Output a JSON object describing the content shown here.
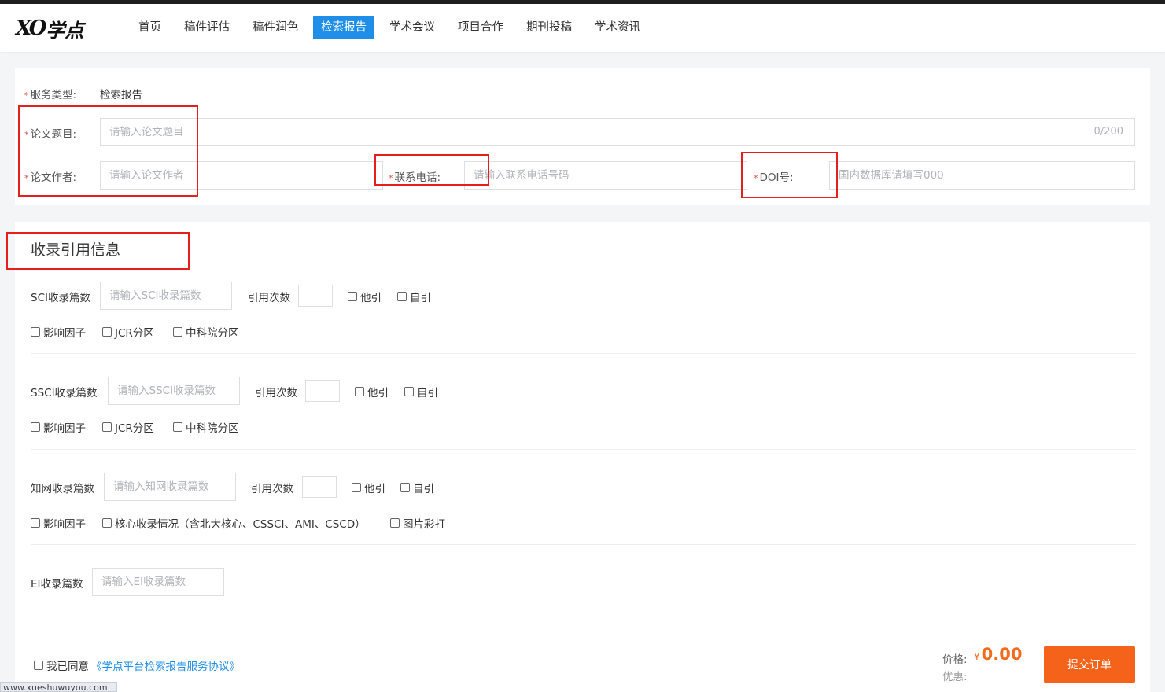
{
  "logo": {
    "mark": "XO",
    "text": "学点"
  },
  "nav": [
    {
      "label": "首页",
      "active": false
    },
    {
      "label": "稿件评估",
      "active": false
    },
    {
      "label": "稿件润色",
      "active": false
    },
    {
      "label": "检索报告",
      "active": true
    },
    {
      "label": "学术会议",
      "active": false
    },
    {
      "label": "项目合作",
      "active": false
    },
    {
      "label": "期刊投稿",
      "active": false
    },
    {
      "label": "学术资讯",
      "active": false
    }
  ],
  "form": {
    "service_type_label": "服务类型:",
    "service_type_value": "检索报告",
    "title_label": "论文题目:",
    "title_placeholder": "请输入论文题目",
    "title_count": "0/200",
    "author_label": "论文作者:",
    "author_placeholder": "请输入论文作者",
    "phone_label": "联系电话:",
    "phone_placeholder": "请输入联系电话号码",
    "doi_label": "DOI号:",
    "doi_placeholder": "国内数据库请填写000"
  },
  "section": {
    "title": "收录引用信息",
    "sci": {
      "label": "SCI收录篇数",
      "placeholder": "请输入SCI收录篇数",
      "cite_label": "引用次数",
      "other_cite": "他引",
      "self_cite": "自引",
      "impact": "影响因子",
      "jcr": "JCR分区",
      "cas": "中科院分区"
    },
    "ssci": {
      "label": "SSCI收录篇数",
      "placeholder": "请输入SSCI收录篇数",
      "cite_label": "引用次数",
      "other_cite": "他引",
      "self_cite": "自引",
      "impact": "影响因子",
      "jcr": "JCR分区",
      "cas": "中科院分区"
    },
    "cnki": {
      "label": "知网收录篇数",
      "placeholder": "请输入知网收录篇数",
      "cite_label": "引用次数",
      "other_cite": "他引",
      "self_cite": "自引",
      "impact": "影响因子",
      "core": "核心收录情况（含北大核心、CSSCI、AMI、CSCD）",
      "color_print": "图片彩打"
    },
    "ei": {
      "label": "EI收录篇数",
      "placeholder": "请输入EI收录篇数"
    }
  },
  "footer": {
    "agree_text": "我已同意",
    "agree_link": "《学点平台检索报告服务协议》",
    "price_label": "价格:",
    "currency": "¥",
    "price_value": "0.00",
    "discount_label": "优惠:",
    "submit_label": "提交订单"
  },
  "status_url": "www.xueshuwuyou.com"
}
